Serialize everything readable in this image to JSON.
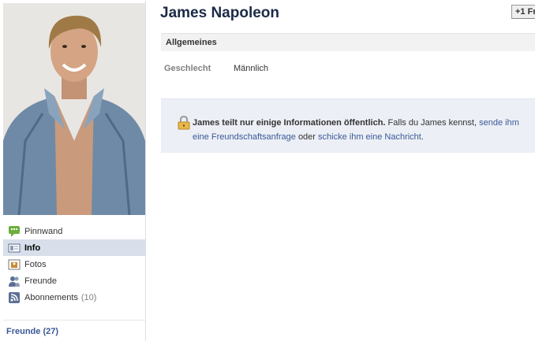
{
  "profile": {
    "name": "James Napoleon",
    "friend_button_label": "+1 Fr"
  },
  "nav": {
    "items": [
      {
        "label": "Pinnwand",
        "icon": "wall-icon"
      },
      {
        "label": "Info",
        "icon": "info-icon",
        "active": true
      },
      {
        "label": "Fotos",
        "icon": "photos-icon"
      },
      {
        "label": "Freunde",
        "icon": "friends-icon"
      },
      {
        "label": "Abonnements",
        "count": "(10)",
        "icon": "subscriptions-icon"
      }
    ]
  },
  "friends_link": "Freunde (27)",
  "section": {
    "title": "Allgemeines",
    "rows": [
      {
        "label": "Geschlecht",
        "value": "Männlich"
      }
    ]
  },
  "privacy": {
    "bold_text": "James teilt nur einige Informationen öffentlich.",
    "text_1": "Falls du James kennst,",
    "link_1": "sende ihm eine Freundschaftsanfrage",
    "text_2": "oder",
    "link_2": "schicke ihm eine Nachricht",
    "text_3": "."
  },
  "colors": {
    "link": "#3b5998",
    "name": "#1c2a47",
    "nav_active_bg": "#d8dfea",
    "privacy_bg": "#eceff5"
  }
}
